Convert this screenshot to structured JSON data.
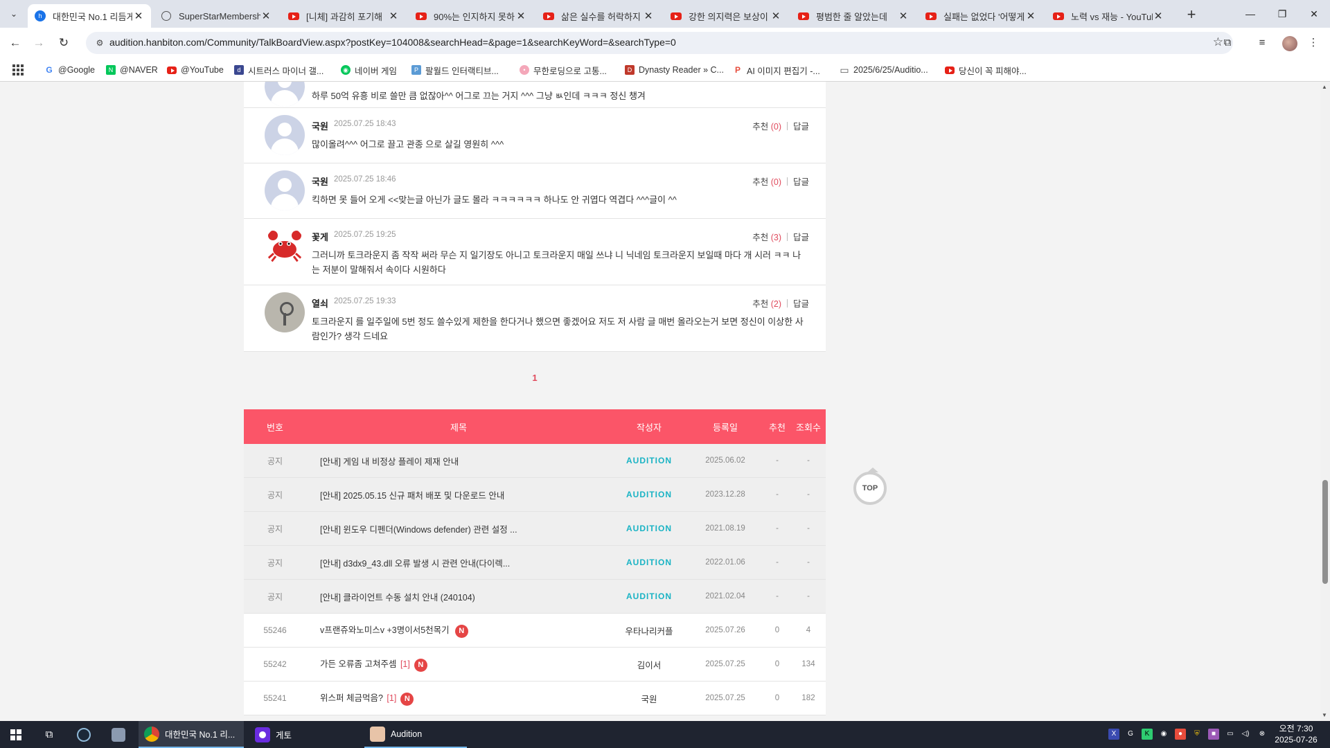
{
  "browser": {
    "tabs": [
      {
        "title": "대한민국 No.1 리듬게",
        "icon": "hanbiton-icon",
        "active": true
      },
      {
        "title": "SuperStarMembership",
        "icon": "globe-icon"
      },
      {
        "title": "[니체] 과감히 포기해",
        "icon": "youtube-icon"
      },
      {
        "title": "90%는 인지하지 못하",
        "icon": "youtube-icon"
      },
      {
        "title": "삶은 실수를 허락하지",
        "icon": "youtube-icon"
      },
      {
        "title": "강한 의지력은 보상이",
        "icon": "youtube-icon"
      },
      {
        "title": "평범한 줄 알았는데 ",
        "icon": "youtube-icon"
      },
      {
        "title": "실패는 없었다 '어떻게",
        "icon": "youtube-icon"
      },
      {
        "title": "노력 vs 재능 - YouTube",
        "icon": "youtube-icon"
      }
    ],
    "url": "audition.hanbiton.com/Community/TalkBoardView.aspx?postKey=104008&searchHead=&page=1&searchKeyWord=&searchType=0",
    "bookmarks": [
      {
        "label": "@Google",
        "icon": "google-icon",
        "color": "#4285f4"
      },
      {
        "label": "@NAVER",
        "icon": "naver-icon",
        "color": "#03c75a"
      },
      {
        "label": "@YouTube",
        "icon": "youtube-icon",
        "color": "#e62117"
      },
      {
        "label": "시트러스 마이너 갤...",
        "icon": "dc-icon",
        "color": "#3b4890"
      },
      {
        "label": "네이버 게임",
        "icon": "naver-game-icon",
        "color": "#03c75a"
      },
      {
        "label": "팔월드 인터랙티브...",
        "icon": "palworld-icon",
        "color": "#5b9bd5"
      },
      {
        "label": "무한로딩으로 고통...",
        "icon": "pig-icon",
        "color": "#f4a7b9"
      },
      {
        "label": "Dynasty Reader » C...",
        "icon": "dynasty-icon",
        "color": "#c0392b"
      },
      {
        "label": "AI 이미지 편집기 -...",
        "icon": "ai-editor-icon",
        "color": "#e74c3c"
      },
      {
        "label": "2025/6/25/Auditio...",
        "icon": "folder-icon",
        "color": "#555555"
      },
      {
        "label": "당신이 꼭 피해야...",
        "icon": "youtube-icon",
        "color": "#e62117"
      }
    ]
  },
  "comments": [
    {
      "author": "",
      "date": "",
      "rec_label": "추천",
      "rec_count": "",
      "reply_label": "답글",
      "text": "하루 50억 유흥 비로 쓸만 큼 없잖아^^ 어그로 끄는 거지 ^^^ 그냥 ㅄ인데 ㅋㅋㅋ 정신 챙겨",
      "avatar": "default"
    },
    {
      "author": "국원",
      "date": "2025.07.25 18:43",
      "rec_label": "추천",
      "rec_count": "(0)",
      "reply_label": "답글",
      "text": "많이올려^^^ 어그로 끌고 관종 으로 살길 영원히 ^^^",
      "avatar": "default"
    },
    {
      "author": "국원",
      "date": "2025.07.25 18:46",
      "rec_label": "추천",
      "rec_count": "(0)",
      "reply_label": "답글",
      "text": "킥하면 못 들어 오게 <<맞는글 아닌가 글도 몰라 ㅋㅋㅋㅋㅋㅋ 하나도 안 귀엽다 역겹다 ^^^글이 ^^",
      "avatar": "default"
    },
    {
      "author": "꽃게",
      "date": "2025.07.25 19:25",
      "rec_label": "추천",
      "rec_count": "(3)",
      "reply_label": "답글",
      "text": "그러니까 토크라운지 좀 작작 써라 무슨 지 일기장도 아니고 토크라운지 매일 쓰냐 니 닉네임 토크라운지 보일때 마다 개 시러 ㅋㅋ 나는 저분이 말해줘서 속이다 시원하다",
      "avatar": "crab"
    },
    {
      "author": "열쇠",
      "date": "2025.07.25 19:33",
      "rec_label": "추천",
      "rec_count": "(2)",
      "reply_label": "답글",
      "text": "토크라운지 를 일주일에 5번 정도 쓸수있게 제한을 한다거나 했으면 좋겠어요 저도 저 사람 글 매번 올라오는거 보면 정신이 이상한 사람인가? 생각 드네요",
      "avatar": "key"
    }
  ],
  "pagination": {
    "current": "1"
  },
  "board": {
    "headers": {
      "no": "번호",
      "title": "제목",
      "author": "작성자",
      "date": "등록일",
      "rec": "추천",
      "views": "조회수"
    },
    "rows": [
      {
        "no": "공지",
        "title": "[안내] 게임 내 비정상 플레이 제재 안내",
        "author": "AUDITION",
        "date": "2025.06.02",
        "rec": "-",
        "views": "-",
        "notice": true
      },
      {
        "no": "공지",
        "title": "[안내] 2025.05.15 신규 패처 배포 및 다운로드 안내",
        "author": "AUDITION",
        "date": "2023.12.28",
        "rec": "-",
        "views": "-",
        "notice": true
      },
      {
        "no": "공지",
        "title": "[안내] 윈도우 디펜더(Windows defender) 관련 설정 ...",
        "author": "AUDITION",
        "date": "2021.08.19",
        "rec": "-",
        "views": "-",
        "notice": true
      },
      {
        "no": "공지",
        "title": "[안내] d3dx9_43.dll 오류 발생 시 관련 안내(다이렉...",
        "author": "AUDITION",
        "date": "2022.01.06",
        "rec": "-",
        "views": "-",
        "notice": true
      },
      {
        "no": "공지",
        "title": "[안내] 클라이언트 수동 설치 안내 (240104)",
        "author": "AUDITION",
        "date": "2021.02.04",
        "rec": "-",
        "views": "-",
        "notice": true
      },
      {
        "no": "55246",
        "title": "v프랜쥬와노미스v    +3명이서5천목기",
        "comment_count": "",
        "badge": "N",
        "author": "우타나리커플",
        "date": "2025.07.26",
        "rec": "0",
        "views": "4",
        "notice": false
      },
      {
        "no": "55242",
        "title": "가든 오류좀 고쳐주셈",
        "comment_count": "[1]",
        "badge": "N",
        "author": "김이서",
        "date": "2025.07.25",
        "rec": "0",
        "views": "134",
        "notice": false
      },
      {
        "no": "55241",
        "title": "위스퍼 체금먹음?",
        "comment_count": "[1]",
        "badge": "N",
        "author": "국원",
        "date": "2025.07.25",
        "rec": "0",
        "views": "182",
        "notice": false
      }
    ]
  },
  "top_button": "TOP",
  "taskbar": {
    "apps": [
      {
        "label": "대한민국 No.1 리...",
        "icon": "chrome-icon"
      },
      {
        "label": "게토",
        "icon": "geto-icon"
      },
      {
        "label": "Audition",
        "icon": "audition-icon"
      }
    ],
    "clock_time": "오전 7:30",
    "clock_date": "2025-07-26"
  },
  "colors": {
    "accent": "#fb5568",
    "audition": "#19b3c4",
    "count": "#e04a5c",
    "new_badge": "#e54545"
  }
}
